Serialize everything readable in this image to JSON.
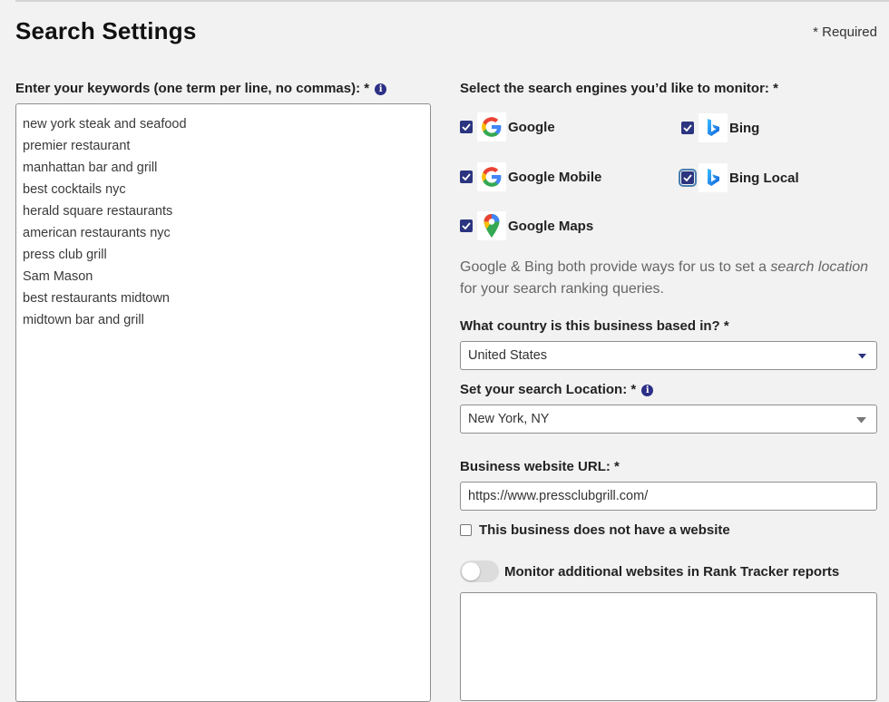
{
  "page": {
    "title": "Search Settings",
    "required_note": "*  Required"
  },
  "keywords": {
    "label": "Enter your keywords (one term per line, no commas): *",
    "items": [
      "new york steak and seafood",
      "premier restaurant",
      "manhattan bar and grill",
      "best cocktails nyc",
      "herald square restaurants",
      "american restaurants nyc",
      "press club grill",
      "Sam Mason",
      "best restaurants midtown",
      "midtown bar and grill"
    ]
  },
  "engines": {
    "label": "Select the search engines you’d like to monitor: *",
    "items": [
      {
        "label": "Google",
        "checked": true,
        "icon": "google-icon"
      },
      {
        "label": "Bing",
        "checked": true,
        "icon": "bing-icon"
      },
      {
        "label": "Google Mobile",
        "checked": true,
        "icon": "google-icon"
      },
      {
        "label": "Bing Local",
        "checked": true,
        "icon": "bing-icon"
      },
      {
        "label": "Google Maps",
        "checked": true,
        "icon": "google-maps-pin-icon"
      }
    ]
  },
  "help": {
    "text_before": "Google & Bing both provide ways for us to set a ",
    "text_emphasis": "search location",
    "text_after": " for your search ranking queries."
  },
  "country": {
    "label": "What country is this business based in? *",
    "value": "United States"
  },
  "location": {
    "label": "Set your search Location: *",
    "value": "New York, NY"
  },
  "website": {
    "label": "Business website URL: *",
    "value": "https://www.pressclubgrill.com/",
    "no_website_label": "This business does not have a website",
    "no_website_checked": false
  },
  "monitor": {
    "label": "Monitor additional websites in Rank Tracker reports",
    "enabled": false
  },
  "colors": {
    "accent": "#2c3580",
    "info": "#2c2f86",
    "background": "#f2f2f2"
  }
}
